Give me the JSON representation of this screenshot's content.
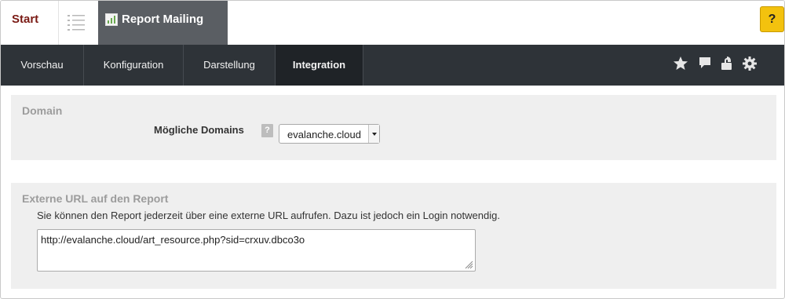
{
  "tabs": {
    "start": "Start",
    "report": "Report Mailing",
    "help": "?"
  },
  "nav": {
    "items": [
      "Vorschau",
      "Konfiguration",
      "Darstellung",
      "Integration"
    ],
    "active": "Integration",
    "icons": [
      "star-icon",
      "comment-icon",
      "unlock-icon",
      "gear-icon"
    ]
  },
  "domain_section": {
    "title": "Domain",
    "field_label": "Mögliche Domains",
    "help": "?",
    "selected": "evalanche.cloud"
  },
  "url_section": {
    "title": "Externe URL auf den Report",
    "description": "Sie können den Report jederzeit über eine externe URL aufrufen. Dazu ist jedoch ein Login notwendig.",
    "url": "http://evalanche.cloud/art_resource.php?sid=crxuv.dbco3o"
  },
  "colors": {
    "nav_bg": "#2e3338",
    "active_tab_bg": "#5a5e63",
    "help_yellow": "#f3c20e",
    "start_red": "#7a1a14"
  }
}
